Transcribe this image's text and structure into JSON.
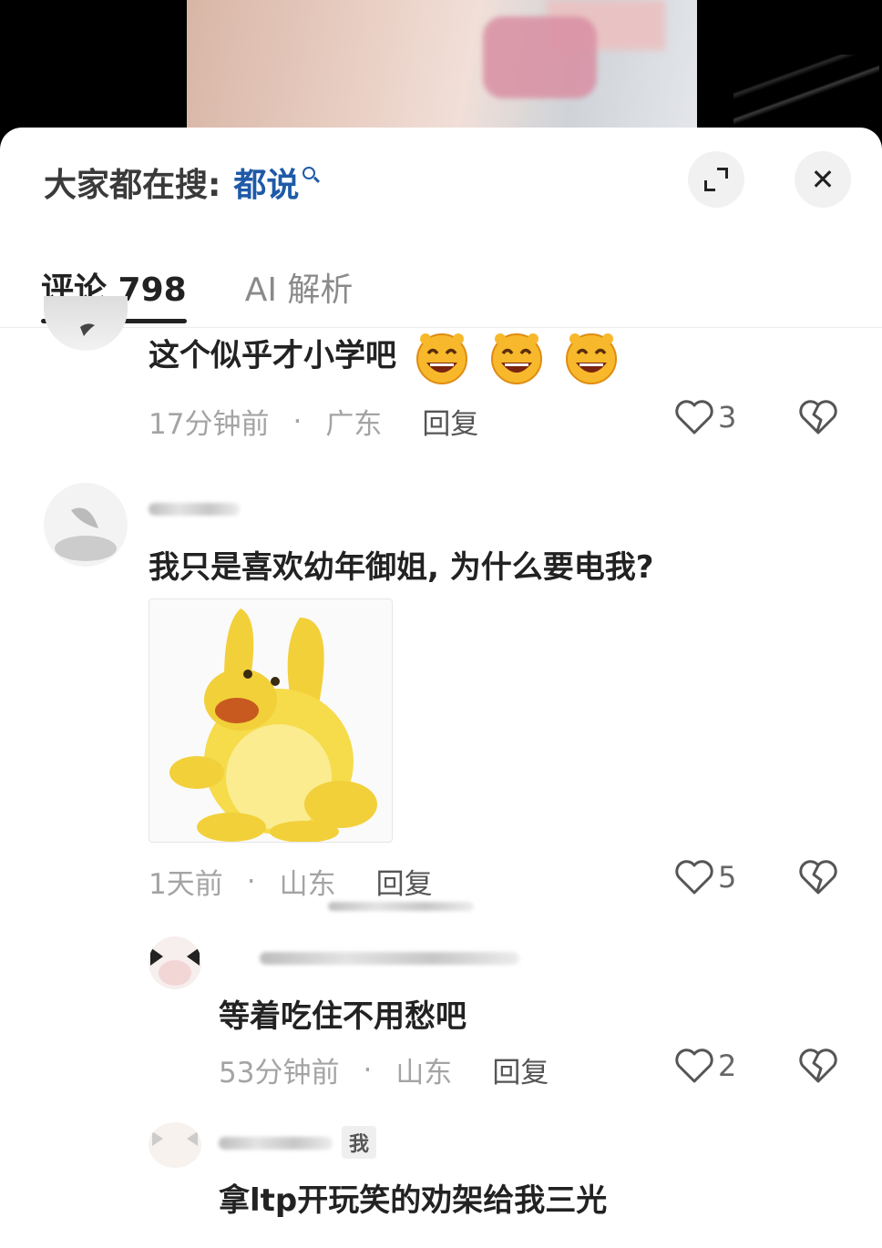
{
  "search": {
    "label": "大家都在搜:",
    "term": "都说"
  },
  "tabs": [
    {
      "label": "评论 798",
      "active": true
    },
    {
      "label": "AI 解析",
      "active": false
    }
  ],
  "comments": [
    {
      "text": "这个似乎才小学吧",
      "time": "17分钟前",
      "dot": "·",
      "location": "广东",
      "reply": "回复",
      "likes": "3"
    },
    {
      "text": "我只是喜欢幼年御姐, 为什么要电我?",
      "time": "1天前",
      "dot": "·",
      "location": "山东",
      "reply": "回复",
      "likes": "5"
    },
    {
      "text": "等着吃住不用愁吧",
      "time": "53分钟前",
      "dot": "·",
      "location": "山东",
      "reply": "回复",
      "likes": "2"
    },
    {
      "text": "拿ltp开玩笑的劝架给我三光",
      "badge": "我"
    }
  ],
  "icons": {
    "heart": "heart-outline-icon",
    "dislike": "broken-heart-icon",
    "expand": "expand-icon",
    "close": "close-icon"
  },
  "colors": {
    "search_term": "#1f5aa8",
    "text": "#222222",
    "meta": "#a4a4a4"
  }
}
